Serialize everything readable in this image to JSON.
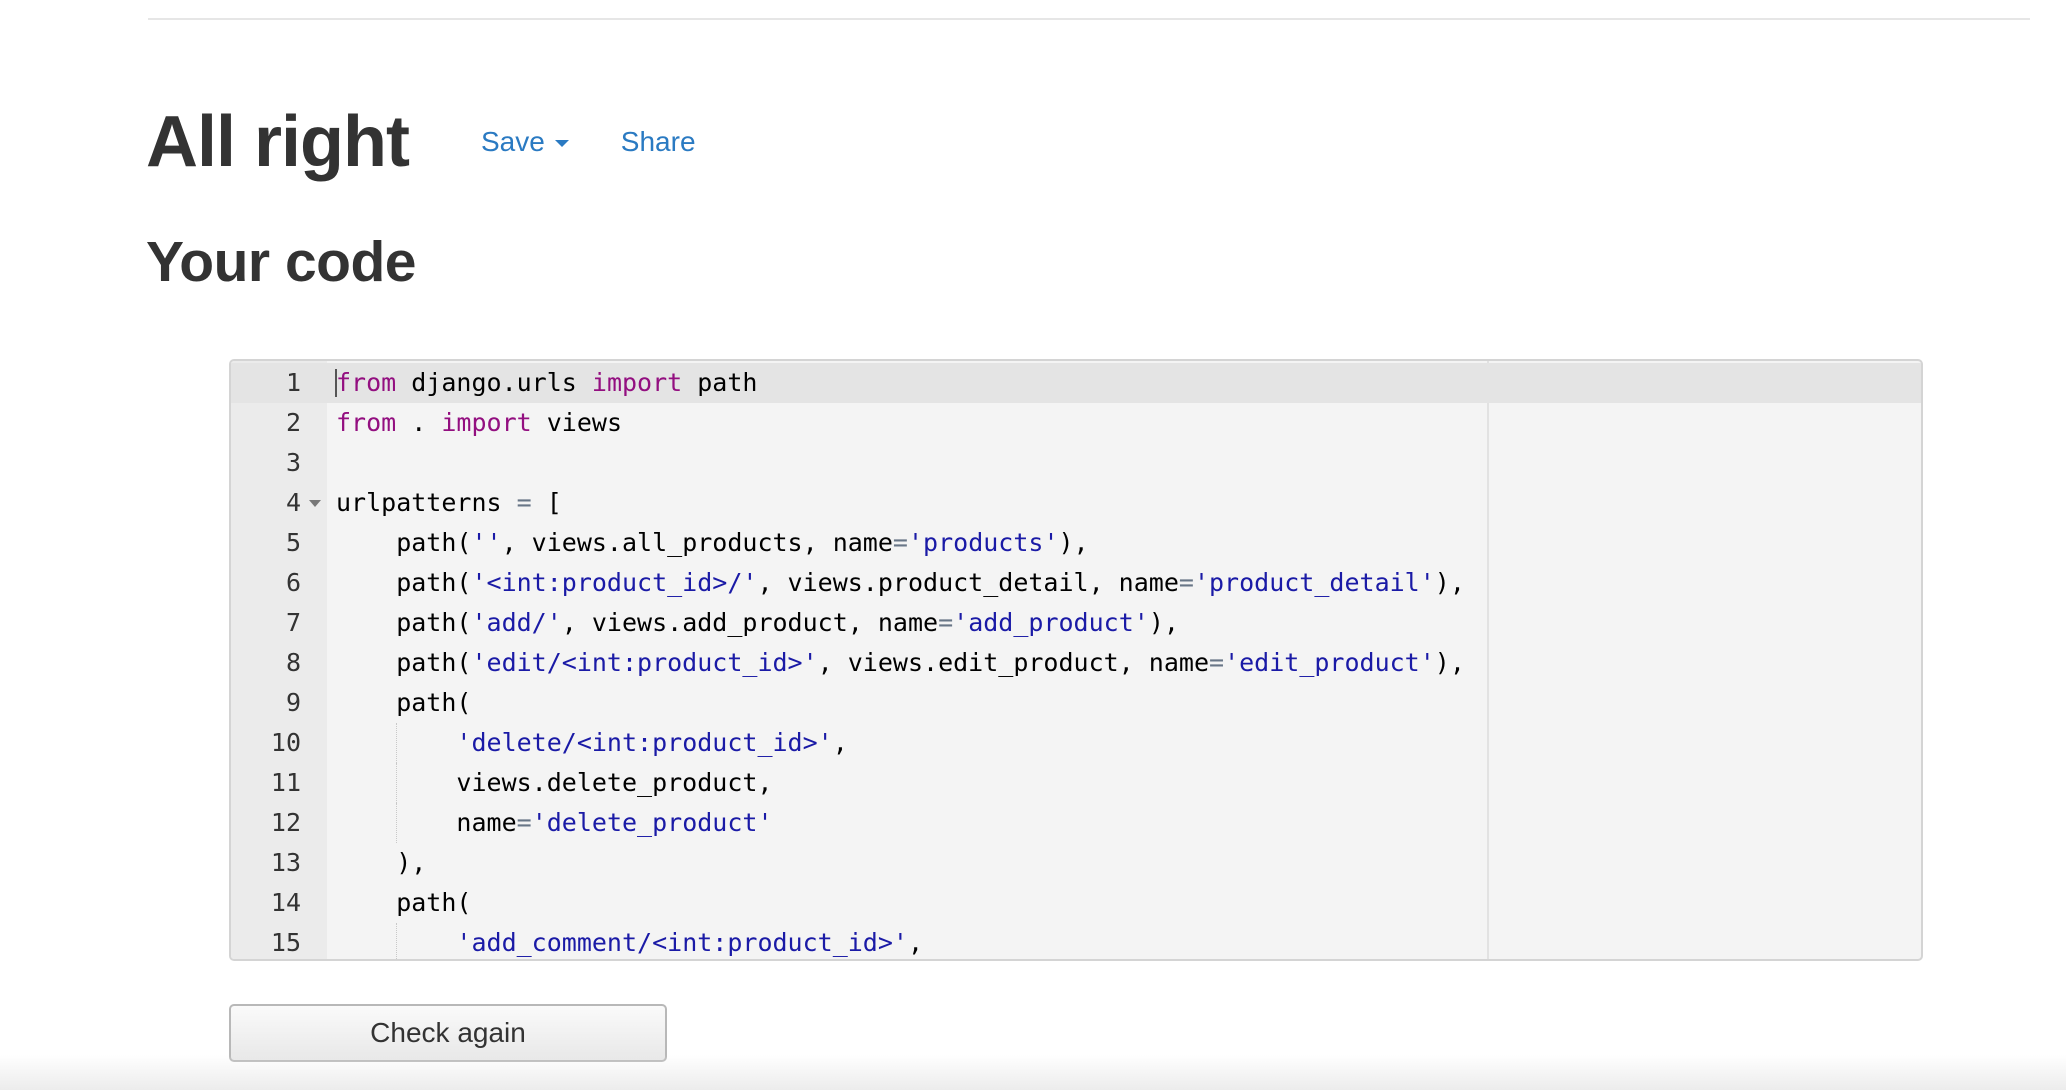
{
  "header": {
    "title": "All right",
    "save_label": "Save",
    "share_label": "Share"
  },
  "section": {
    "title": "Your code"
  },
  "editor": {
    "lines": [
      {
        "num": "1",
        "tokens": [
          {
            "t": "from",
            "c": "kw"
          },
          {
            "t": " django.urls ",
            "c": ""
          },
          {
            "t": "import",
            "c": "kw"
          },
          {
            "t": " path",
            "c": ""
          }
        ]
      },
      {
        "num": "2",
        "tokens": [
          {
            "t": "from",
            "c": "kw"
          },
          {
            "t": " . ",
            "c": ""
          },
          {
            "t": "import",
            "c": "kw"
          },
          {
            "t": " views",
            "c": ""
          }
        ]
      },
      {
        "num": "3",
        "tokens": []
      },
      {
        "num": "4",
        "fold": true,
        "tokens": [
          {
            "t": "urlpatterns ",
            "c": ""
          },
          {
            "t": "=",
            "c": "op"
          },
          {
            "t": " [",
            "c": ""
          }
        ]
      },
      {
        "num": "5",
        "tokens": [
          {
            "t": "    path(",
            "c": ""
          },
          {
            "t": "''",
            "c": "str"
          },
          {
            "t": ", views.all_products, name",
            "c": ""
          },
          {
            "t": "=",
            "c": "op"
          },
          {
            "t": "'products'",
            "c": "str"
          },
          {
            "t": "),",
            "c": ""
          }
        ]
      },
      {
        "num": "6",
        "tokens": [
          {
            "t": "    path(",
            "c": ""
          },
          {
            "t": "'<int:product_id>/'",
            "c": "str"
          },
          {
            "t": ", views.product_detail, name",
            "c": ""
          },
          {
            "t": "=",
            "c": "op"
          },
          {
            "t": "'product_detail'",
            "c": "str"
          },
          {
            "t": "),",
            "c": ""
          }
        ]
      },
      {
        "num": "7",
        "tokens": [
          {
            "t": "    path(",
            "c": ""
          },
          {
            "t": "'add/'",
            "c": "str"
          },
          {
            "t": ", views.add_product, name",
            "c": ""
          },
          {
            "t": "=",
            "c": "op"
          },
          {
            "t": "'add_product'",
            "c": "str"
          },
          {
            "t": "),",
            "c": ""
          }
        ]
      },
      {
        "num": "8",
        "tokens": [
          {
            "t": "    path(",
            "c": ""
          },
          {
            "t": "'edit/<int:product_id>'",
            "c": "str"
          },
          {
            "t": ", views.edit_product, name",
            "c": ""
          },
          {
            "t": "=",
            "c": "op"
          },
          {
            "t": "'edit_product'",
            "c": "str"
          },
          {
            "t": "),",
            "c": ""
          }
        ]
      },
      {
        "num": "9",
        "tokens": [
          {
            "t": "    path(",
            "c": ""
          }
        ]
      },
      {
        "num": "10",
        "guide": true,
        "tokens": [
          {
            "t": "        ",
            "c": ""
          },
          {
            "t": "'delete/<int:product_id>'",
            "c": "str"
          },
          {
            "t": ",",
            "c": ""
          }
        ]
      },
      {
        "num": "11",
        "guide": true,
        "tokens": [
          {
            "t": "        views.delete_product,",
            "c": ""
          }
        ]
      },
      {
        "num": "12",
        "guide": true,
        "tokens": [
          {
            "t": "        name",
            "c": ""
          },
          {
            "t": "=",
            "c": "op"
          },
          {
            "t": "'delete_product'",
            "c": "str"
          }
        ]
      },
      {
        "num": "13",
        "tokens": [
          {
            "t": "    ),",
            "c": ""
          }
        ]
      },
      {
        "num": "14",
        "tokens": [
          {
            "t": "    path(",
            "c": ""
          }
        ]
      },
      {
        "num": "15",
        "guide": true,
        "tokens": [
          {
            "t": "        ",
            "c": ""
          },
          {
            "t": "'add_comment/<int:product_id>'",
            "c": "str"
          },
          {
            "t": ",",
            "c": ""
          }
        ]
      }
    ]
  },
  "actions": {
    "check_again_label": "Check again"
  },
  "colors": {
    "link": "#2a7ac2",
    "keyword": "#930f80",
    "string": "#1a1aa6",
    "operator": "#687687"
  }
}
